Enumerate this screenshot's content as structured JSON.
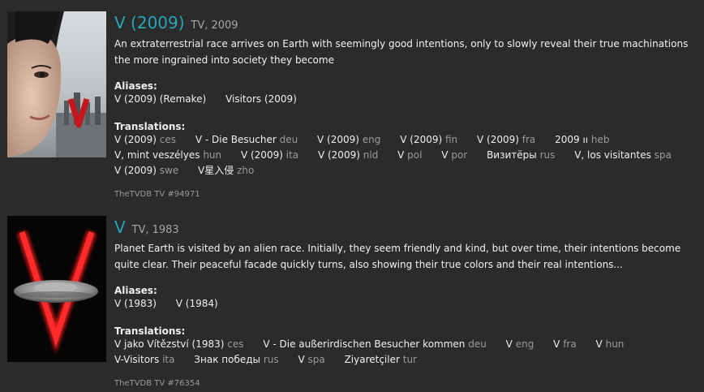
{
  "results": [
    {
      "title": "V (2009)",
      "type_year": "TV, 2009",
      "overview": "An extraterrestrial race arrives on Earth with seemingly good intentions, only to slowly reveal their true machinations the more ingrained into society they become",
      "aliases_label": "Aliases:",
      "aliases": [
        "V (2009) (Remake)",
        "Visitors (2009)"
      ],
      "translations_label": "Translations:",
      "translations": [
        {
          "name": "V (2009)",
          "lang": "ces"
        },
        {
          "name": "V - Die Besucher",
          "lang": "deu"
        },
        {
          "name": "V (2009)",
          "lang": "eng"
        },
        {
          "name": "V (2009)",
          "lang": "fin"
        },
        {
          "name": "V (2009)",
          "lang": "fra"
        },
        {
          "name": "2009 וו",
          "lang": "heb"
        },
        {
          "name": "V, mint veszélyes",
          "lang": "hun"
        },
        {
          "name": "V (2009)",
          "lang": "ita"
        },
        {
          "name": "V (2009)",
          "lang": "nld"
        },
        {
          "name": "V",
          "lang": "pol"
        },
        {
          "name": "V",
          "lang": "por"
        },
        {
          "name": "Визитёры",
          "lang": "rus"
        },
        {
          "name": "V, los visitantes",
          "lang": "spa"
        },
        {
          "name": "V (2009)",
          "lang": "swe"
        },
        {
          "name": "V星入侵",
          "lang": "zho"
        }
      ],
      "source": "TheTVDB TV #94971"
    },
    {
      "title": "V",
      "type_year": "TV, 1983",
      "overview": "Planet Earth is visited by an alien race. Initially, they seem friendly and kind, but over time, their intentions become quite clear. Their peaceful facade quickly turns, also showing their true colors and their real intentions...",
      "aliases_label": "Aliases:",
      "aliases": [
        "V (1983)",
        "V (1984)"
      ],
      "translations_label": "Translations:",
      "translations": [
        {
          "name": "V jako Vítězství (1983)",
          "lang": "ces"
        },
        {
          "name": "V - Die außerirdischen Besucher kommen",
          "lang": "deu"
        },
        {
          "name": "V",
          "lang": "eng"
        },
        {
          "name": "V",
          "lang": "fra"
        },
        {
          "name": "V",
          "lang": "hun"
        },
        {
          "name": "V-Visitors",
          "lang": "ita"
        },
        {
          "name": "Знак победы",
          "lang": "rus"
        },
        {
          "name": "V",
          "lang": "spa"
        },
        {
          "name": "Ziyaretçiler",
          "lang": "tur"
        }
      ],
      "source": "TheTVDB TV #76354"
    }
  ],
  "colors": {
    "background": "#2b2b2b",
    "title": "#26a6b8",
    "muted": "#9a9a9a",
    "text": "#f0f0f0"
  }
}
